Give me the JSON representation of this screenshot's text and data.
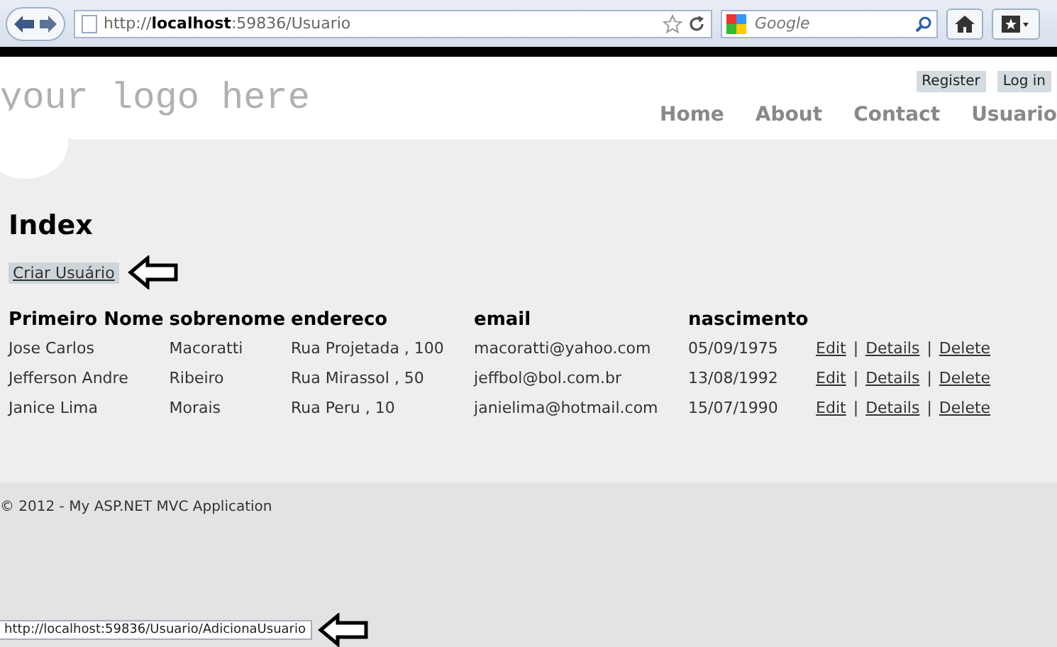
{
  "browser": {
    "url": "http://**localhost**:59836/Usuario",
    "search_placeholder": "Google"
  },
  "header": {
    "logo": "your logo here",
    "account_links": [
      "Register",
      "Log in"
    ],
    "nav": [
      "Home",
      "About",
      "Contact",
      "Usuario"
    ]
  },
  "page": {
    "title": "Index",
    "create_link": "Criar Usuário"
  },
  "table": {
    "columns": [
      "Primeiro Nome",
      "sobrenome",
      "endereco",
      "email",
      "nascimento"
    ],
    "rows": [
      {
        "cells": [
          "Jose Carlos",
          "Macoratti",
          "Rua Projetada , 100",
          "macoratti@yahoo.com",
          "05/09/1975"
        ],
        "actions": [
          "Edit",
          "Details",
          "Delete"
        ]
      },
      {
        "cells": [
          "Jefferson Andre",
          "Ribeiro",
          "Rua Mirassol , 50",
          "jeffbol@bol.com.br",
          "13/08/1992"
        ],
        "actions": [
          "Edit",
          "Details",
          "Delete"
        ]
      },
      {
        "cells": [
          "Janice Lima",
          "Morais",
          "Rua Peru , 10",
          "janielima@hotmail.com",
          "15/07/1990"
        ],
        "actions": [
          "Edit",
          "Details",
          "Delete"
        ]
      }
    ],
    "separator": "|"
  },
  "footer": {
    "text": "© 2012 - My ASP.NET MVC Application"
  },
  "status_bar": {
    "url": "http://localhost:59836/Usuario/AdicionaUsuario"
  }
}
